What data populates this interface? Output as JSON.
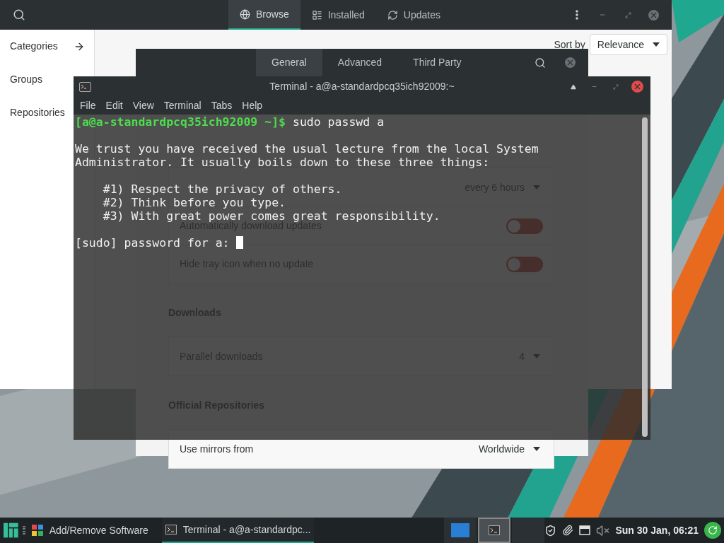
{
  "main_window": {
    "tabs": [
      {
        "label": "Browse",
        "selected": true
      },
      {
        "label": "Installed",
        "selected": false
      },
      {
        "label": "Updates",
        "selected": false
      }
    ],
    "sidebar": {
      "items": [
        {
          "label": "Categories",
          "expanded": true
        },
        {
          "label": "Groups",
          "expanded": false
        },
        {
          "label": "Repositories",
          "expanded": false
        }
      ]
    },
    "sort_by": {
      "label": "Sort by",
      "value": "Relevance"
    }
  },
  "preferences": {
    "tabs": [
      {
        "label": "General",
        "selected": true
      },
      {
        "label": "Advanced",
        "selected": false
      },
      {
        "label": "Third Party",
        "selected": false
      }
    ],
    "sections": [
      {
        "rows": [
          {
            "kind": "dropdown",
            "value": "every 6 hours"
          },
          {
            "kind": "toggle",
            "label": "Automatically download updates",
            "on": false
          },
          {
            "kind": "toggle",
            "label": "Hide tray icon when no update",
            "on": false
          }
        ]
      },
      {
        "heading": "Downloads",
        "rows": [
          {
            "kind": "dropdown",
            "label": "Parallel downloads",
            "value": "4"
          }
        ]
      },
      {
        "heading": "Official Repositories",
        "rows": [
          {
            "kind": "dropdown",
            "label": "Use mirrors from",
            "value": "Worldwide"
          }
        ]
      }
    ]
  },
  "terminal": {
    "title": "Terminal - a@a-standardpcq35ich92009:~",
    "menu": [
      "File",
      "Edit",
      "View",
      "Terminal",
      "Tabs",
      "Help"
    ],
    "lines": [
      {
        "kind": "prompt",
        "prompt": "[a@a-standardpcq35ich92009 ~]$",
        "command": "sudo passwd a"
      },
      {
        "kind": "blank"
      },
      {
        "kind": "text",
        "text": "We trust you have received the usual lecture from the local System"
      },
      {
        "kind": "text",
        "text": "Administrator. It usually boils down to these three things:"
      },
      {
        "kind": "blank"
      },
      {
        "kind": "text",
        "text": "    #1) Respect the privacy of others."
      },
      {
        "kind": "text",
        "text": "    #2) Think before you type."
      },
      {
        "kind": "text",
        "text": "    #3) With great power comes great responsibility."
      },
      {
        "kind": "blank"
      },
      {
        "kind": "input",
        "text": "[sudo] password for a: "
      }
    ]
  },
  "taskbar": {
    "windows": [
      {
        "label": "Add/Remove Software",
        "selected": false
      },
      {
        "label": "Terminal - a@a-standardpc...",
        "selected": true
      }
    ],
    "workspaces": [
      {
        "selected": false
      },
      {
        "selected": true
      },
      {
        "selected": false
      }
    ],
    "clock": "Sun 30 Jan, 06:21"
  }
}
